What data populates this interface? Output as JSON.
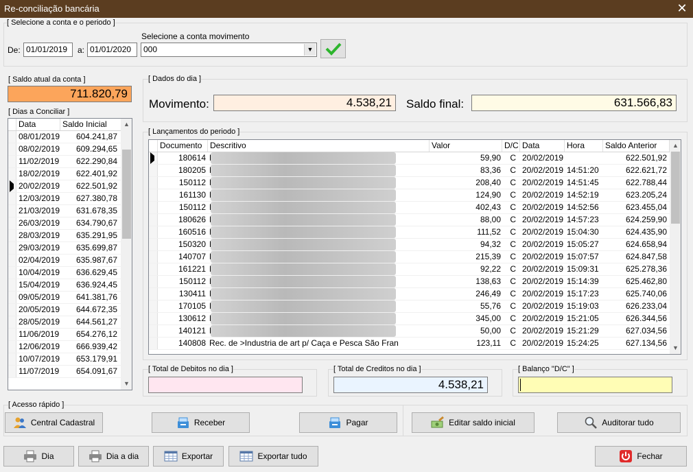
{
  "window": {
    "title": "Re-conciliação bancária",
    "close": "✕"
  },
  "period": {
    "group_label": "[ Selecione a conta e o periodo ]",
    "from_label": "De:",
    "from": "01/01/2019",
    "to_label": "a:",
    "to": "01/01/2020",
    "account_label": "Selecione a conta  movimento",
    "account": "000"
  },
  "saldo_atual": {
    "label": "[ Saldo atual da conta  ]",
    "value": "711.820,79"
  },
  "dias": {
    "label": "[ Dias a Conciliar ]",
    "columns": [
      "Data",
      "Saldo Inicial"
    ],
    "rows": [
      [
        "08/01/2019",
        "604.241,87"
      ],
      [
        "08/02/2019",
        "609.294,65"
      ],
      [
        "11/02/2019",
        "622.290,84"
      ],
      [
        "18/02/2019",
        "622.401,92"
      ],
      [
        "20/02/2019",
        "622.501,92"
      ],
      [
        "12/03/2019",
        "627.380,78"
      ],
      [
        "21/03/2019",
        "631.678,35"
      ],
      [
        "26/03/2019",
        "634.790,67"
      ],
      [
        "28/03/2019",
        "635.291,95"
      ],
      [
        "29/03/2019",
        "635.699,87"
      ],
      [
        "02/04/2019",
        "635.987,67"
      ],
      [
        "10/04/2019",
        "636.629,45"
      ],
      [
        "15/04/2019",
        "636.924,45"
      ],
      [
        "09/05/2019",
        "641.381,76"
      ],
      [
        "20/05/2019",
        "644.672,35"
      ],
      [
        "28/05/2019",
        "644.561,27"
      ],
      [
        "11/06/2019",
        "654.276,12"
      ],
      [
        "12/06/2019",
        "666.939,42"
      ],
      [
        "10/07/2019",
        "653.179,91"
      ],
      [
        "11/07/2019",
        "654.091,67"
      ]
    ],
    "selected_index": 4
  },
  "dados_dia": {
    "label": "[ Dados do dia ]",
    "movimento_label": "Movimento:",
    "movimento": "4.538,21",
    "saldo_final_label": "Saldo final:",
    "saldo_final": "631.566,83"
  },
  "lancamentos": {
    "label": "[ Lançamentos do periodo ]",
    "columns": [
      "Documento",
      "Descritivo",
      "Valor",
      "D/C",
      "Data",
      "Hora",
      "Saldo Anterior"
    ],
    "rows": [
      [
        "180614",
        "Rec. de",
        "59,90",
        "C",
        "20/02/2019",
        "",
        "622.501,92"
      ],
      [
        "180205",
        "Rec. de",
        "83,36",
        "C",
        "20/02/2019",
        "14:51:20",
        "622.621,72"
      ],
      [
        "150112",
        "Rec. de",
        "208,40",
        "C",
        "20/02/2019",
        "14:51:45",
        "622.788,44"
      ],
      [
        "161130",
        "Rec. de",
        "124,90",
        "C",
        "20/02/2019",
        "14:52:19",
        "623.205,24"
      ],
      [
        "150112",
        "Rec. de",
        "402,43",
        "C",
        "20/02/2019",
        "14:52:56",
        "623.455,04"
      ],
      [
        "180626",
        "Rec. de",
        "88,00",
        "C",
        "20/02/2019",
        "14:57:23",
        "624.259,90"
      ],
      [
        "160516",
        "Rec. de",
        "111,52",
        "C",
        "20/02/2019",
        "15:04:30",
        "624.435,90"
      ],
      [
        "150320",
        "Rec. de",
        "94,32",
        "C",
        "20/02/2019",
        "15:05:27",
        "624.658,94"
      ],
      [
        "140707",
        "Rec. de",
        "215,39",
        "C",
        "20/02/2019",
        "15:07:57",
        "624.847,58"
      ],
      [
        "161221",
        "Rec. de",
        "92,22",
        "C",
        "20/02/2019",
        "15:09:31",
        "625.278,36"
      ],
      [
        "150112",
        "Rec. de",
        "138,63",
        "C",
        "20/02/2019",
        "15:14:39",
        "625.462,80"
      ],
      [
        "130411",
        "Rec. de",
        "246,49",
        "C",
        "20/02/2019",
        "15:17:23",
        "625.740,06"
      ],
      [
        "170105",
        "Rec. de",
        "55,76",
        "C",
        "20/02/2019",
        "15:19:03",
        "626.233,04"
      ],
      [
        "130612",
        "Rec. de",
        "345,00",
        "C",
        "20/02/2019",
        "15:21:05",
        "626.344,56"
      ],
      [
        "140121",
        "Rec. de",
        "50,00",
        "C",
        "20/02/2019",
        "15:21:29",
        "627.034,56"
      ],
      [
        "140808",
        "Rec. de >Industria de art p/ Caça e Pesca São Fran",
        "123,11",
        "C",
        "20/02/2019",
        "15:24:25",
        "627.134,56"
      ]
    ]
  },
  "totals": {
    "debitos_label": "[ Total de Debitos no dia ]",
    "debitos": "",
    "creditos_label": "[ Total de Creditos no dia ]",
    "creditos": "4.538,21",
    "balanco_label": "[ Balanço \"D/C\" ]",
    "balanco": ""
  },
  "acesso": {
    "label": "[ Acesso rápido ]",
    "central": "Central Cadastral",
    "receber": "Receber",
    "pagar": "Pagar",
    "editar": "Editar saldo inicial",
    "auditar": "Auditorar tudo"
  },
  "footer": {
    "dia": "Dia",
    "dia_a_dia": "Dia a dia",
    "exportar": "Exportar",
    "exportar_tudo": "Exportar tudo",
    "fechar": "Fechar"
  }
}
